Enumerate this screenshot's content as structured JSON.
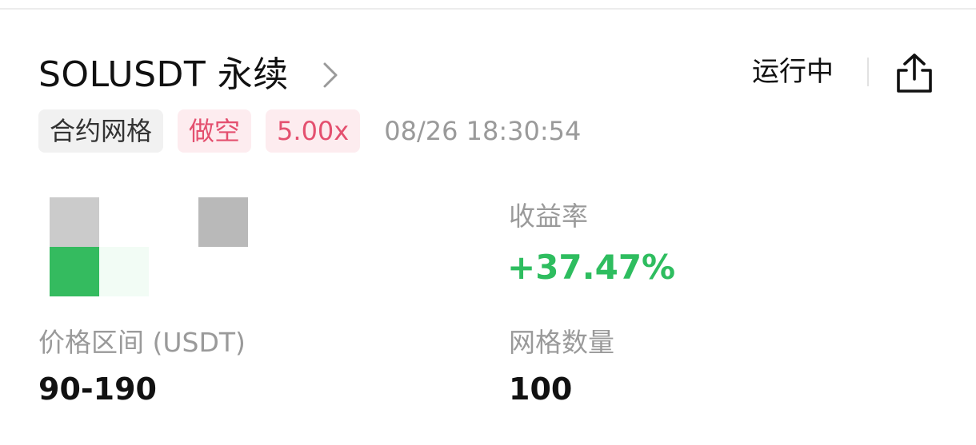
{
  "header": {
    "title": "SOLUSDT 永续",
    "status": "运行中"
  },
  "tags": {
    "type": "合约网格",
    "direction": "做空",
    "leverage": "5.00x",
    "timestamp": "08/26 18:30:54"
  },
  "stats": {
    "yield_label": "收益率",
    "yield_value": "+37.47%",
    "price_range_label": "价格区间 (USDT)",
    "price_range_value": "90-190",
    "grid_count_label": "网格数量",
    "grid_count_value": "100"
  },
  "icons": {
    "chevron": "chevron-right-icon",
    "share": "share-icon"
  },
  "colors": {
    "positive": "#2ebd5f",
    "tag_red_text": "#e4506f",
    "tag_red_bg": "#fdecef",
    "tag_gray_bg": "#f1f1f1",
    "muted_text": "#9a9a9a"
  }
}
